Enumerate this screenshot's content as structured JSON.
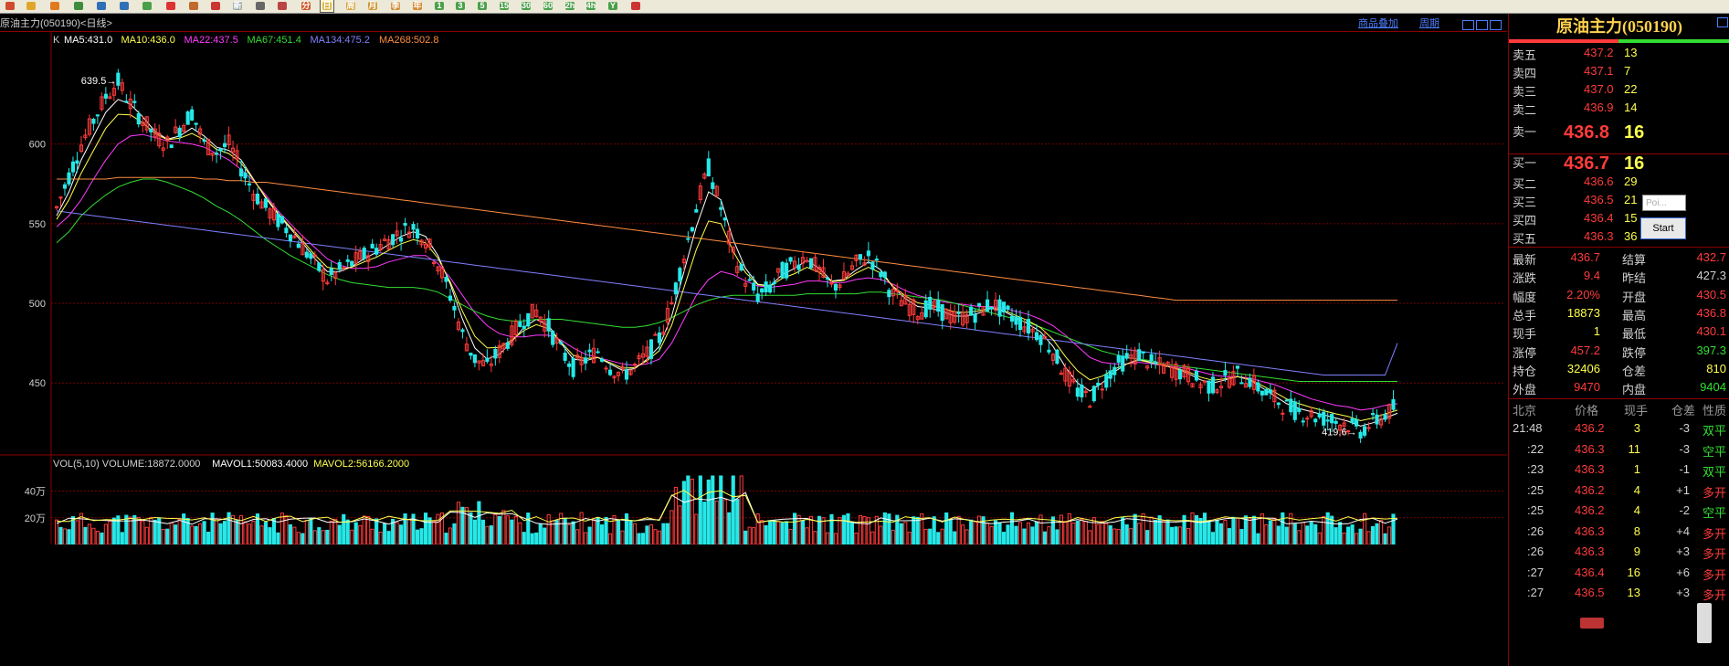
{
  "toolbar": {
    "buttons": [
      {
        "icon": "home-icon",
        "color": "#d04b2e",
        "glyph": ""
      },
      {
        "icon": "notebook-icon",
        "color": "#e1a52b",
        "glyph": ""
      },
      {
        "icon": "folder-icon",
        "color": "#e07a1f",
        "glyph": ""
      },
      {
        "icon": "refresh-icon",
        "color": "#3e8c3e",
        "glyph": ""
      },
      {
        "icon": "zoom-in-icon",
        "color": "#2f6fb8",
        "glyph": ""
      },
      {
        "icon": "zoom-out-icon",
        "color": "#2f6fb8",
        "glyph": ""
      },
      {
        "icon": "grid-icon",
        "color": "#4aa04a",
        "glyph": ""
      },
      {
        "icon": "pencil-icon",
        "color": "#d33",
        "glyph": ""
      },
      {
        "icon": "wrench-icon",
        "color": "#c06a2b",
        "glyph": ""
      },
      {
        "icon": "pin-icon",
        "color": "#c33",
        "glyph": ""
      },
      {
        "icon": "new-icon",
        "color": "#9aa",
        "glyph": "新"
      },
      {
        "icon": "table-icon",
        "color": "#666",
        "glyph": ""
      },
      {
        "icon": "chart-icon",
        "color": "#b44",
        "glyph": ""
      },
      {
        "icon": "minute-icon",
        "color": "#d05a2b",
        "glyph": "分"
      },
      {
        "icon": "day-icon",
        "color": "#d6b44a",
        "glyph": "日"
      },
      {
        "icon": "week-icon",
        "color": "#d6a23a",
        "glyph": "周"
      },
      {
        "icon": "month-icon",
        "color": "#d09a3a",
        "glyph": "月"
      },
      {
        "icon": "quarter-icon",
        "color": "#cf8e36",
        "glyph": "季"
      },
      {
        "icon": "year-icon",
        "color": "#d78b30",
        "glyph": "年"
      },
      {
        "icon": "period-1-icon",
        "color": "#4aa04a",
        "glyph": "1"
      },
      {
        "icon": "period-3-icon",
        "color": "#4aa04a",
        "glyph": "3"
      },
      {
        "icon": "period-5-icon",
        "color": "#4aa04a",
        "glyph": "5"
      },
      {
        "icon": "period-15-icon",
        "color": "#4aa04a",
        "glyph": "15"
      },
      {
        "icon": "period-30-icon",
        "color": "#4aa04a",
        "glyph": "30"
      },
      {
        "icon": "period-60-icon",
        "color": "#4aa04a",
        "glyph": "60"
      },
      {
        "icon": "period-2h-icon",
        "color": "#4aa04a",
        "glyph": "2h"
      },
      {
        "icon": "period-4h-icon",
        "color": "#4aa04a",
        "glyph": "4h"
      },
      {
        "icon": "period-y-icon",
        "color": "#4aa04a",
        "glyph": "Y"
      },
      {
        "icon": "calendar-icon",
        "color": "#c33",
        "glyph": ""
      }
    ]
  },
  "titlebar": {
    "instrument": "原油主力(050190)<日线>",
    "link_add_product": "商品叠加",
    "link_period": "周期"
  },
  "kline": {
    "label": "K",
    "ma": [
      {
        "text": "MA5:431.0",
        "color": "#ffffff"
      },
      {
        "text": "MA10:436.0",
        "color": "#ffff4d"
      },
      {
        "text": "MA22:437.5",
        "color": "#ff3bff"
      },
      {
        "text": "MA67:451.4",
        "color": "#33dd33"
      },
      {
        "text": "MA134:475.2",
        "color": "#8080ff"
      },
      {
        "text": "MA268:502.8",
        "color": "#ff8c40"
      }
    ],
    "y_ticks": [
      "600",
      "550",
      "500",
      "450"
    ],
    "high_label": "639.5",
    "low_label": "419.6"
  },
  "volume": {
    "header": [
      {
        "text": "VOL(5,10) VOLUME:18872.0000",
        "color": "#d0d0d0"
      },
      {
        "text": "MAVOL1:50083.4000",
        "color": "#ffffff"
      },
      {
        "text": "MAVOL2:56166.2000",
        "color": "#ffff4d"
      }
    ],
    "y_ticks": [
      "40万",
      "20万"
    ]
  },
  "quote": {
    "title": "原油主力(050190)",
    "asks": [
      {
        "label": "卖五",
        "price": "437.2",
        "vol": "13"
      },
      {
        "label": "卖四",
        "price": "437.1",
        "vol": "7"
      },
      {
        "label": "卖三",
        "price": "437.0",
        "vol": "22"
      },
      {
        "label": "卖二",
        "price": "436.9",
        "vol": "14"
      },
      {
        "label": "卖一",
        "price": "436.8",
        "vol": "16"
      }
    ],
    "bids": [
      {
        "label": "买一",
        "price": "436.7",
        "vol": "16"
      },
      {
        "label": "买二",
        "price": "436.6",
        "vol": "29"
      },
      {
        "label": "买三",
        "price": "436.5",
        "vol": "21"
      },
      {
        "label": "买四",
        "price": "436.4",
        "vol": "15"
      },
      {
        "label": "买五",
        "price": "436.3",
        "vol": "36"
      }
    ],
    "stats": [
      {
        "l1": "最新",
        "v1": "436.7",
        "c1": "#ff3b3b",
        "l2": "结算",
        "v2": "432.7",
        "c2": "#ff3b3b"
      },
      {
        "l1": "涨跌",
        "v1": "9.4",
        "c1": "#ff3b3b",
        "l2": "昨结",
        "v2": "427.3",
        "c2": "#d0d0d0"
      },
      {
        "l1": "幅度",
        "v1": "2.20%",
        "c1": "#ff3b3b",
        "l2": "开盘",
        "v2": "430.5",
        "c2": "#ff3b3b"
      },
      {
        "l1": "总手",
        "v1": "18873",
        "c1": "#ffff4d",
        "l2": "最高",
        "v2": "436.8",
        "c2": "#ff3b3b"
      },
      {
        "l1": "现手",
        "v1": "1",
        "c1": "#ffff4d",
        "l2": "最低",
        "v2": "430.1",
        "c2": "#ff3b3b"
      },
      {
        "l1": "涨停",
        "v1": "457.2",
        "c1": "#ff3b3b",
        "l2": "跌停",
        "v2": "397.3",
        "c2": "#33dd33"
      },
      {
        "l1": "持仓",
        "v1": "32406",
        "c1": "#ffff4d",
        "l2": "仓差",
        "v2": "810",
        "c2": "#ffff4d"
      },
      {
        "l1": "外盘",
        "v1": "9470",
        "c1": "#ff3b3b",
        "l2": "内盘",
        "v2": "9404",
        "c2": "#33dd33"
      }
    ],
    "tick_header": [
      "北京",
      "价格",
      "现手",
      "仓差",
      "性质"
    ],
    "ticks": [
      {
        "time": "21:48",
        "price": "436.2",
        "vol": "3",
        "oi": "-3",
        "nature": "双平",
        "nc": "#33dd33"
      },
      {
        "time": ":22",
        "price": "436.3",
        "vol": "11",
        "oi": "-3",
        "nature": "空平",
        "nc": "#33dd33"
      },
      {
        "time": ":23",
        "price": "436.3",
        "vol": "1",
        "oi": "-1",
        "nature": "双平",
        "nc": "#33dd33"
      },
      {
        "time": ":25",
        "price": "436.2",
        "vol": "4",
        "oi": "+1",
        "nature": "多开",
        "nc": "#ff3b3b"
      },
      {
        "time": ":25",
        "price": "436.2",
        "vol": "4",
        "oi": "-2",
        "nature": "空平",
        "nc": "#33dd33"
      },
      {
        "time": ":26",
        "price": "436.3",
        "vol": "8",
        "oi": "+4",
        "nature": "多开",
        "nc": "#ff3b3b"
      },
      {
        "time": ":26",
        "price": "436.3",
        "vol": "9",
        "oi": "+3",
        "nature": "多开",
        "nc": "#ff3b3b"
      },
      {
        "time": ":27",
        "price": "436.4",
        "vol": "16",
        "oi": "+6",
        "nature": "多开",
        "nc": "#ff3b3b"
      },
      {
        "time": ":27",
        "price": "436.5",
        "vol": "13",
        "oi": "+3",
        "nature": "多开",
        "nc": "#ff3b3b"
      }
    ]
  },
  "overlay": {
    "input_placeholder": "Poi...",
    "start_label": "Start"
  },
  "colors": {
    "up": "#ff3b3b",
    "down": "#26e8e8",
    "grid": "#7a0000",
    "axis": "#8b0000"
  },
  "chart_data": {
    "type": "candlestick",
    "series_ma": [
      {
        "name": "MA5",
        "color": "#ffffff"
      },
      {
        "name": "MA10",
        "color": "#ffff4d"
      },
      {
        "name": "MA22",
        "color": "#ff3bff"
      },
      {
        "name": "MA67",
        "color": "#33dd33"
      },
      {
        "name": "MA134",
        "color": "#8080ff"
      },
      {
        "name": "MA268",
        "color": "#ff8c40"
      }
    ],
    "ylim": [
      410,
      660
    ],
    "price_path": [
      560,
      580,
      600,
      615,
      630,
      639,
      625,
      615,
      605,
      600,
      610,
      620,
      600,
      595,
      600,
      585,
      570,
      560,
      552,
      545,
      535,
      525,
      515,
      520,
      525,
      530,
      535,
      540,
      545,
      548,
      540,
      525,
      505,
      480,
      465,
      460,
      470,
      480,
      490,
      495,
      485,
      470,
      460,
      465,
      470,
      460,
      455,
      460,
      468,
      478,
      500,
      530,
      560,
      585,
      560,
      530,
      515,
      505,
      510,
      520,
      525,
      530,
      520,
      510,
      515,
      525,
      530,
      520,
      505,
      500,
      495,
      498,
      495,
      490,
      492,
      495,
      500,
      495,
      490,
      485,
      480,
      470,
      455,
      445,
      440,
      450,
      460,
      465,
      468,
      462,
      460,
      458,
      455,
      450,
      448,
      452,
      455,
      452,
      445,
      440,
      435,
      432,
      430,
      428,
      426,
      424,
      420,
      425,
      430,
      436
    ],
    "ma5_path": [
      555,
      570,
      590,
      605,
      620,
      628,
      625,
      617,
      608,
      603,
      605,
      610,
      605,
      598,
      596,
      590,
      578,
      566,
      556,
      547,
      538,
      528,
      520,
      520,
      523,
      528,
      532,
      537,
      542,
      545,
      542,
      530,
      512,
      490,
      472,
      465,
      468,
      476,
      485,
      490,
      486,
      475,
      465,
      464,
      466,
      462,
      458,
      459,
      465,
      473,
      492,
      520,
      548,
      570,
      565,
      540,
      522,
      512,
      511,
      518,
      522,
      527,
      522,
      514,
      515,
      521,
      526,
      521,
      510,
      503,
      498,
      497,
      495,
      492,
      492,
      494,
      497,
      495,
      491,
      487,
      482,
      473,
      460,
      450,
      445,
      450,
      457,
      462,
      465,
      463,
      461,
      459,
      456,
      452,
      450,
      452,
      454,
      452,
      447,
      442,
      437,
      434,
      432,
      430,
      428,
      426,
      423,
      425,
      428,
      431
    ],
    "ma22_path": [
      548,
      555,
      565,
      578,
      590,
      600,
      605,
      606,
      604,
      602,
      601,
      600,
      598,
      594,
      590,
      584,
      577,
      568,
      558,
      550,
      542,
      535,
      528,
      524,
      522,
      522,
      523,
      526,
      528,
      530,
      530,
      525,
      516,
      505,
      494,
      486,
      481,
      479,
      479,
      480,
      480,
      477,
      472,
      468,
      466,
      464,
      462,
      461,
      462,
      465,
      475,
      490,
      505,
      515,
      520,
      518,
      514,
      511,
      510,
      511,
      512,
      514,
      514,
      513,
      513,
      515,
      516,
      515,
      512,
      508,
      505,
      503,
      501,
      500,
      499,
      498,
      498,
      497,
      495,
      493,
      490,
      486,
      480,
      473,
      466,
      463,
      462,
      462,
      463,
      462,
      461,
      460,
      459,
      457,
      455,
      454,
      454,
      453,
      451,
      449,
      446,
      443,
      440,
      438,
      436,
      435,
      433,
      434,
      436,
      437
    ],
    "ma67_path": [
      538,
      545,
      555,
      562,
      568,
      573,
      576,
      578,
      578,
      576,
      573,
      570,
      566,
      561,
      557,
      552,
      546,
      540,
      535,
      530,
      526,
      522,
      518,
      515,
      513,
      512,
      511,
      510,
      510,
      510,
      509,
      507,
      503,
      499,
      495,
      492,
      490,
      489,
      489,
      490,
      490,
      490,
      489,
      488,
      487,
      486,
      485,
      485,
      486,
      488,
      491,
      495,
      499,
      502,
      504,
      505,
      505,
      505,
      505,
      505,
      505,
      506,
      506,
      506,
      506,
      506,
      507,
      507,
      506,
      505,
      504,
      503,
      502,
      500,
      498,
      496,
      494,
      492,
      490,
      488,
      485,
      482,
      479,
      476,
      473,
      470,
      468,
      466,
      465,
      464,
      462,
      461,
      460,
      459,
      458,
      457,
      456,
      455,
      454,
      453,
      452,
      451,
      451,
      451,
      451,
      451,
      451,
      451,
      451,
      451
    ],
    "ma134_path": [
      558,
      557,
      556,
      555,
      554,
      553,
      552,
      551,
      550,
      549,
      548,
      547,
      546,
      545,
      544,
      543,
      542,
      541,
      540,
      539,
      538,
      537,
      536,
      535,
      534,
      533,
      532,
      531,
      530,
      529,
      528,
      527,
      526,
      525,
      524,
      523,
      522,
      521,
      520,
      519,
      518,
      517,
      516,
      515,
      514,
      513,
      512,
      511,
      510,
      509,
      508,
      507,
      506,
      505,
      504,
      503,
      502,
      501,
      500,
      499,
      498,
      497,
      496,
      495,
      494,
      493,
      492,
      491,
      490,
      489,
      488,
      487,
      486,
      485,
      484,
      483,
      482,
      481,
      480,
      479,
      478,
      477,
      476,
      475,
      474,
      473,
      472,
      471,
      470,
      469,
      468,
      467,
      466,
      465,
      464,
      463,
      462,
      461,
      460,
      459,
      458,
      457,
      456,
      455,
      455,
      455,
      455,
      455,
      455,
      475
    ],
    "ma268_path": [
      578,
      578,
      578,
      578,
      578,
      579,
      579,
      579,
      579,
      579,
      579,
      579,
      578,
      578,
      577,
      577,
      576,
      576,
      575,
      574,
      573,
      572,
      571,
      570,
      569,
      568,
      567,
      566,
      565,
      564,
      563,
      562,
      561,
      560,
      559,
      558,
      557,
      556,
      555,
      554,
      553,
      552,
      551,
      550,
      549,
      548,
      547,
      546,
      545,
      544,
      543,
      542,
      541,
      540,
      539,
      538,
      537,
      536,
      535,
      534,
      533,
      532,
      531,
      530,
      529,
      528,
      527,
      526,
      525,
      524,
      523,
      522,
      521,
      520,
      519,
      518,
      517,
      516,
      515,
      514,
      513,
      512,
      511,
      510,
      509,
      508,
      507,
      506,
      505,
      504,
      503,
      502,
      502,
      502,
      502,
      502,
      502,
      502,
      502,
      502,
      502,
      502,
      502,
      502,
      502,
      502,
      502,
      502,
      502,
      502
    ]
  }
}
